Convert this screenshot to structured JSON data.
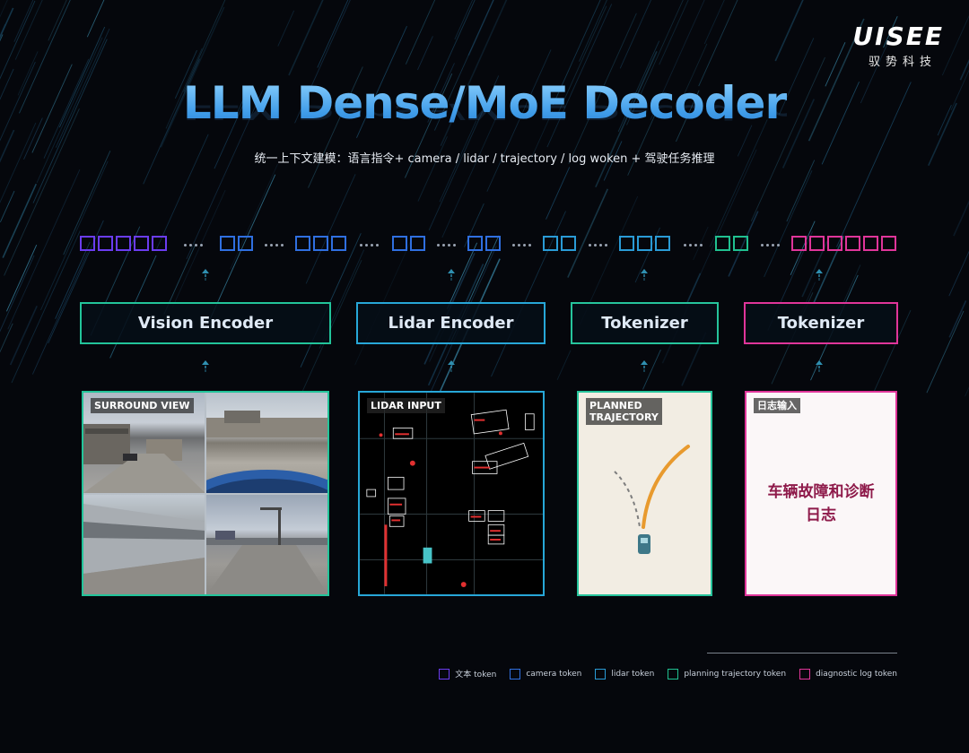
{
  "logo": {
    "main": "UISEE",
    "sub": "驭势科技"
  },
  "title": "LLM Dense/MoE Decoder",
  "subtitle": "统一上下文建模：语言指令+ camera / lidar / trajectory / log woken + 驾驶任务推理",
  "colors": {
    "text_token": "#6b3cf0",
    "camera_token": "#2f6fe0",
    "lidar_token": "#2a9bd6",
    "planning_token": "#20c090",
    "diagnostic_token": "#e0359a",
    "vision_encoder_border": "#22c49a",
    "lidar_encoder_border": "#27a7d8",
    "tokenizer_traj_border": "#26c49c",
    "tokenizer_diag_border": "#e0359a"
  },
  "token_groups": [
    {
      "type": "text_token",
      "count": 5
    },
    {
      "type": "camera_token",
      "count": 2
    },
    {
      "type": "camera_token",
      "count": 3
    },
    {
      "type": "camera_token",
      "count": 2
    },
    {
      "type": "camera_token",
      "count": 2
    },
    {
      "type": "lidar_token",
      "count": 2
    },
    {
      "type": "lidar_token",
      "count": 3
    },
    {
      "type": "planning_token",
      "count": 2
    },
    {
      "type": "diagnostic_token",
      "count": 6
    }
  ],
  "encoders": {
    "vision": "Vision Encoder",
    "lidar": "Lidar Encoder",
    "tokenizer_traj": "Tokenizer",
    "tokenizer_diag": "Tokenizer"
  },
  "panels": {
    "surround": {
      "label": "SURROUND VIEW"
    },
    "lidar": {
      "label": "LIDAR INPUT"
    },
    "trajectory": {
      "label_line1": "PLANNED",
      "label_line2": "TRAJECTORY"
    },
    "diagnostic": {
      "label": "日志输入",
      "text_line1": "车辆故障和诊断",
      "text_line2": "日志"
    }
  },
  "legend": [
    {
      "label": "文本 token",
      "type": "text_token"
    },
    {
      "label": "camera token",
      "type": "camera_token"
    },
    {
      "label": "lidar token",
      "type": "lidar_token"
    },
    {
      "label": "planning trajectory token",
      "type": "planning_token"
    },
    {
      "label": "diagnostic log token",
      "type": "diagnostic_token"
    }
  ]
}
